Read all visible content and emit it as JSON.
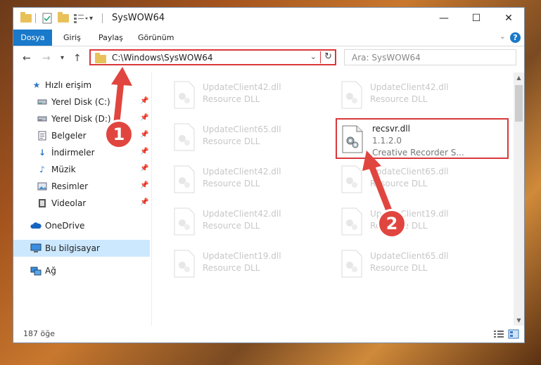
{
  "window": {
    "title": "SysWOW64",
    "controls": {
      "minimize": "—",
      "maximize": "☐",
      "close": "✕"
    }
  },
  "ribbon": {
    "tabs": [
      "Dosya",
      "Giriş",
      "Paylaş",
      "Görünüm"
    ],
    "help": "?"
  },
  "address": {
    "path": "C:\\Windows\\SysWOW64",
    "search_placeholder": "Ara: SysWOW64"
  },
  "sidebar": {
    "items": [
      {
        "label": "Hızlı erişim",
        "icon": "star-icon"
      },
      {
        "label": "Yerel Disk (C:)",
        "icon": "drive-icon"
      },
      {
        "label": "Yerel Disk (D:)",
        "icon": "drive-icon"
      },
      {
        "label": "Belgeler",
        "icon": "documents-icon"
      },
      {
        "label": "İndirmeler",
        "icon": "download-icon"
      },
      {
        "label": "Müzik",
        "icon": "music-icon"
      },
      {
        "label": "Resimler",
        "icon": "pictures-icon"
      },
      {
        "label": "Videolar",
        "icon": "video-icon"
      },
      {
        "label": "OneDrive",
        "icon": "cloud-icon"
      },
      {
        "label": "Bu bilgisayar",
        "icon": "computer-icon"
      },
      {
        "label": "Ağ",
        "icon": "network-icon"
      }
    ]
  },
  "files": {
    "left_column": [
      {
        "name": "UpdateClient42.dll",
        "desc": "Resource DLL"
      },
      {
        "name": "UpdateClient65.dll",
        "desc": "Resource DLL"
      },
      {
        "name": "UpdateClient42.dll",
        "desc": "Resource DLL"
      },
      {
        "name": "UpdateClient42.dll",
        "desc": "Resource DLL"
      },
      {
        "name": "UpdateClient19.dll",
        "desc": "Resource DLL"
      }
    ],
    "right_column": [
      {
        "name": "UpdateClient42.dll",
        "desc": "Resource DLL"
      },
      {
        "name": "UpdateClient65.dll",
        "desc": "Resource DLL"
      },
      {
        "name": "UpdateClient19.dll",
        "desc": "Resource DLL"
      },
      {
        "name": "UpdateClient65.dll",
        "desc": "Resource DLL"
      }
    ],
    "highlighted": {
      "name": "recsvr.dll",
      "version": "1.1.2.0",
      "desc": "Creative Recorder S..."
    }
  },
  "status": {
    "item_count": "187 öğe"
  },
  "annotations": {
    "step1": "1",
    "step2": "2"
  },
  "colors": {
    "accent": "#1979ca",
    "highlight": "#d9383a",
    "selected": "#cce8ff"
  }
}
